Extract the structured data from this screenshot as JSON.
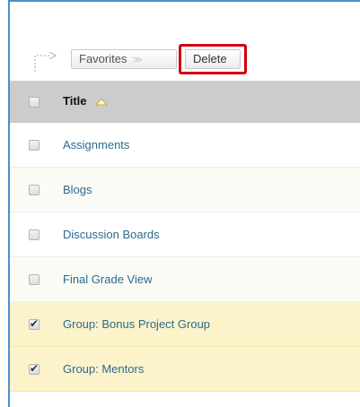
{
  "toolbar": {
    "favorites_label": "Favorites",
    "favorites_chevron": "≫",
    "delete_label": "Delete"
  },
  "table": {
    "header": {
      "title_label": "Title",
      "sort_icon": "sort-ascending-icon"
    },
    "rows": [
      {
        "title": "Assignments",
        "checked": false
      },
      {
        "title": "Blogs",
        "checked": false
      },
      {
        "title": "Discussion Boards",
        "checked": false
      },
      {
        "title": "Final Grade View",
        "checked": false
      },
      {
        "title": "Group: Bonus Project Group",
        "checked": true
      },
      {
        "title": "Group: Mentors",
        "checked": true
      }
    ]
  },
  "colors": {
    "frame_border": "#4a90c9",
    "highlight_border": "#d0000f",
    "link": "#2a6b8f",
    "header_bg": "#cccccc",
    "selected_row_bg": "#fdf3cb"
  },
  "icons": {
    "toolbar_arrow": "bent-arrow-icon",
    "checkbox_checked": "checkmark-icon"
  }
}
